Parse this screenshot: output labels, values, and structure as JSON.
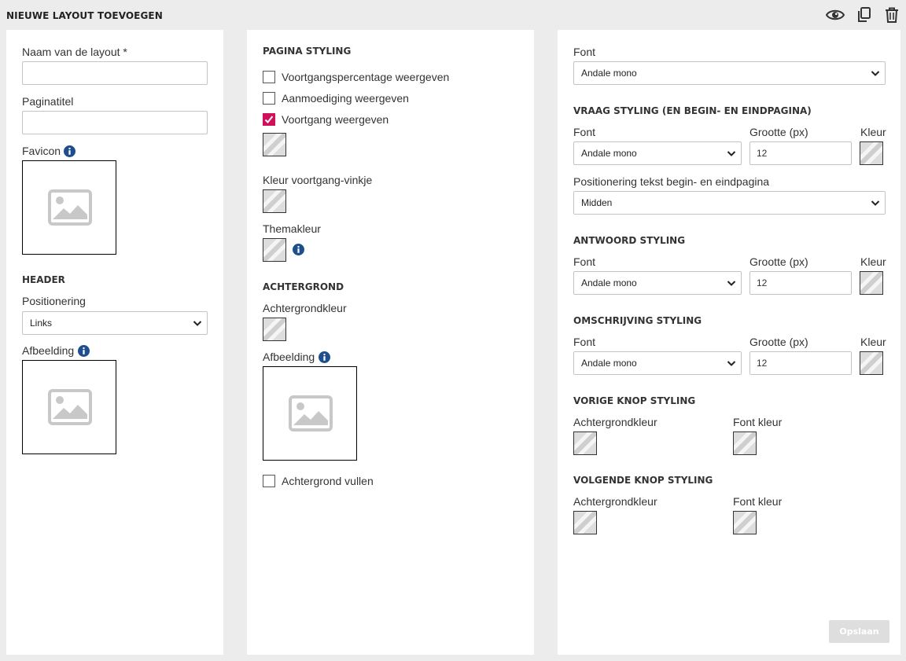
{
  "page": {
    "title": "NIEUWE LAYOUT TOEVOEGEN",
    "icons": [
      "eye-icon",
      "copy-icon",
      "trash-icon"
    ]
  },
  "panel1": {
    "layout_name_label": "Naam van de layout *",
    "layout_name_value": "",
    "page_title_label": "Paginatitel",
    "page_title_value": "",
    "favicon_label": "Favicon",
    "header_section": "HEADER",
    "positioning_label": "Positionering",
    "positioning_value": "Links",
    "image_label": "Afbeelding"
  },
  "panel2": {
    "page_styling_section": "PAGINA STYLING",
    "checkbox_progress_percentage": "Voortgangspercentage weergeven",
    "checkbox_progress_percentage_checked": false,
    "checkbox_encouragement": "Aanmoediging weergeven",
    "checkbox_encouragement_checked": false,
    "checkbox_progress": "Voortgang weergeven",
    "checkbox_progress_checked": true,
    "progress_check_color_label": "Kleur voortgang-vinkje",
    "theme_color_label": "Themakleur",
    "background_section": "ACHTERGROND",
    "background_color_label": "Achtergrondkleur",
    "background_image_label": "Afbeelding",
    "checkbox_fill_background": "Achtergrond vullen",
    "checkbox_fill_background_checked": false
  },
  "panel3": {
    "font_label": "Font",
    "font_value": "Andale mono",
    "question_section": "VRAAG STYLING (EN BEGIN- EN EINDPAGINA)",
    "question_font_label": "Font",
    "question_font_value": "Andale mono",
    "question_size_label": "Grootte (px)",
    "question_size_value": "12",
    "question_color_label": "Kleur",
    "text_position_label": "Positionering tekst begin- en eindpagina",
    "text_position_value": "Midden",
    "answer_section": "ANTWOORD STYLING",
    "answer_font_label": "Font",
    "answer_font_value": "Andale mono",
    "answer_size_label": "Grootte (px)",
    "answer_size_value": "12",
    "answer_color_label": "Kleur",
    "description_section": "OMSCHRIJVING STYLING",
    "description_font_label": "Font",
    "description_font_value": "Andale mono",
    "description_size_label": "Grootte (px)",
    "description_size_value": "12",
    "description_color_label": "Kleur",
    "prev_button_section": "VORIGE KNOP STYLING",
    "prev_bg_label": "Achtergrondkleur",
    "prev_font_color_label": "Font kleur",
    "next_button_section": "VOLGENDE KNOP STYLING",
    "next_bg_label": "Achtergrondkleur",
    "next_font_color_label": "Font kleur",
    "save_label": "Opslaan"
  },
  "colors": {
    "accent": "#d0105a",
    "info": "#1f4e8c",
    "background": "#ececec",
    "save_disabled": "#dedede"
  }
}
